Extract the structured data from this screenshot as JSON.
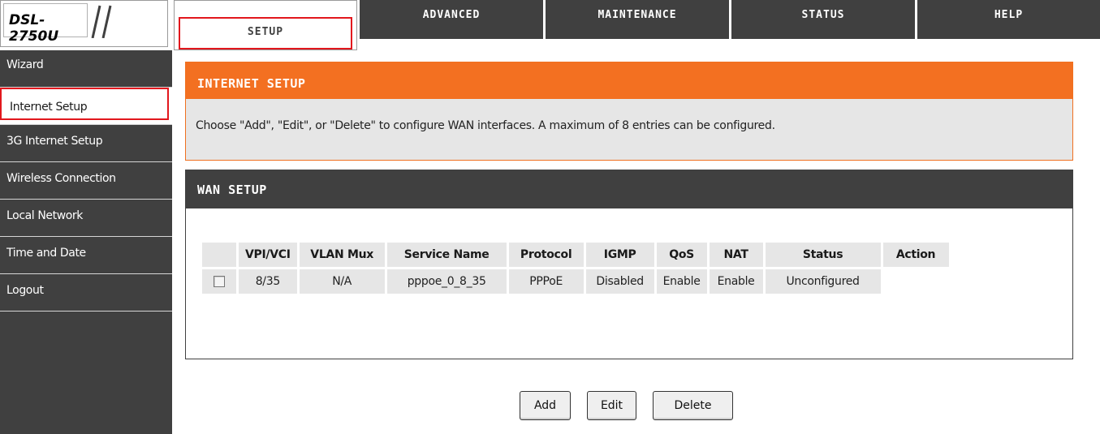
{
  "logo": {
    "model": "DSL-2750U"
  },
  "nav": {
    "tabs": [
      {
        "label": "SETUP"
      },
      {
        "label": "ADVANCED"
      },
      {
        "label": "MAINTENANCE"
      },
      {
        "label": "STATUS"
      },
      {
        "label": "HELP"
      }
    ]
  },
  "sidebar": {
    "items": [
      {
        "label": "Wizard"
      },
      {
        "label": "Internet Setup"
      },
      {
        "label": "3G Internet Setup"
      },
      {
        "label": "Wireless Connection"
      },
      {
        "label": "Local Network"
      },
      {
        "label": "Time and Date"
      },
      {
        "label": "Logout"
      }
    ]
  },
  "internet_setup": {
    "title": "INTERNET SETUP",
    "description": "Choose \"Add\", \"Edit\", or \"Delete\" to configure WAN interfaces. A maximum of 8 entries can be configured."
  },
  "wan_setup": {
    "title": "WAN SETUP",
    "columns": [
      "",
      "VPI/VCI",
      "VLAN Mux",
      "Service Name",
      "Protocol",
      "IGMP",
      "QoS",
      "NAT",
      "Status",
      "Action"
    ],
    "rows": [
      {
        "checked": false,
        "vpi_vci": "8/35",
        "vlan_mux": "N/A",
        "service_name": "pppoe_0_8_35",
        "protocol": "PPPoE",
        "igmp": "Disabled",
        "qos": "Enable",
        "nat": "Enable",
        "status": "Unconfigured",
        "action": ""
      }
    ]
  },
  "buttons": {
    "add": "Add",
    "edit": "Edit",
    "delete": "Delete"
  },
  "colors": {
    "orange": "#f37021",
    "dark": "#404040",
    "highlight": "#e2171d",
    "panel": "#e6e6e6"
  }
}
